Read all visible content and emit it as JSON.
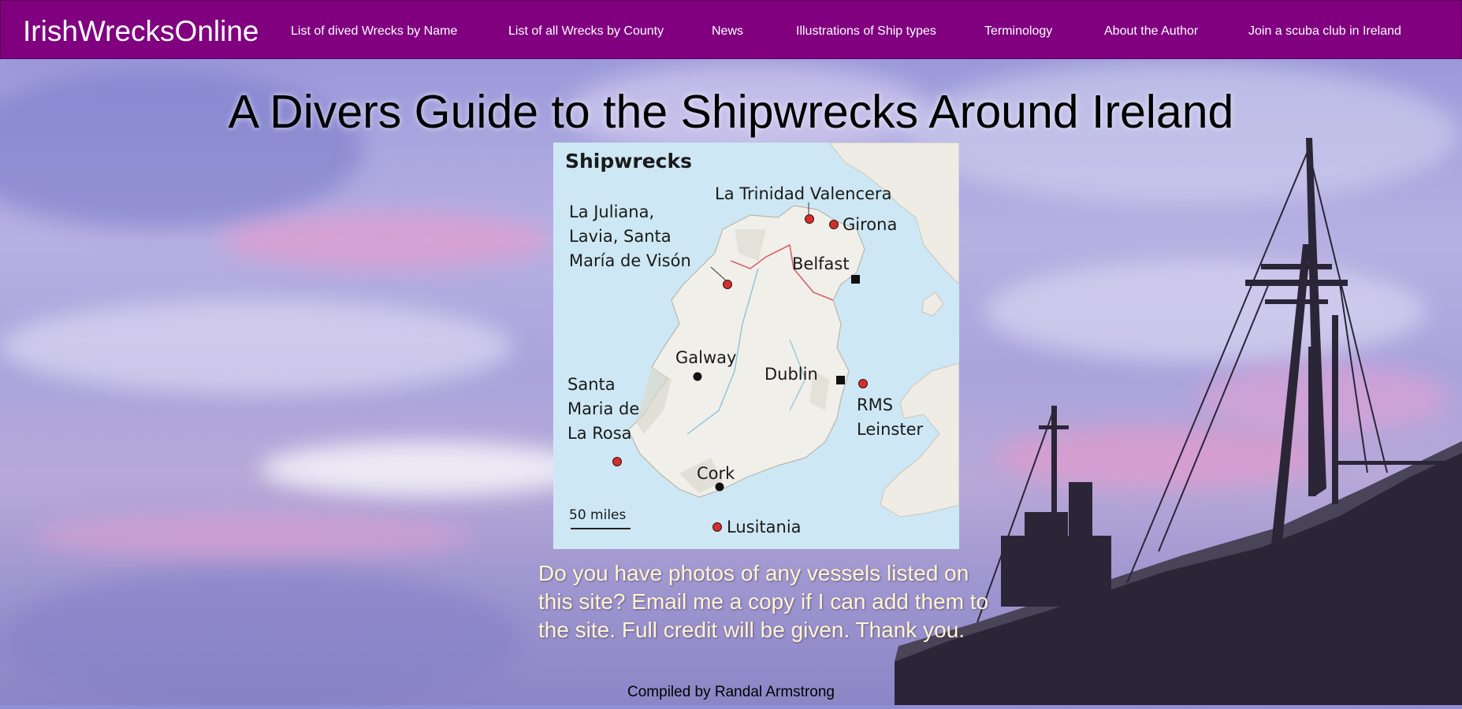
{
  "nav": {
    "brand": "IrishWrecksOnline",
    "links": [
      {
        "label": "List of dived Wrecks by Name"
      },
      {
        "label": "List of all Wrecks by County"
      },
      {
        "label": "News"
      },
      {
        "label": "Illustrations of Ship types"
      },
      {
        "label": "Terminology"
      },
      {
        "label": "About the Author"
      },
      {
        "label": "Join a scuba club in Ireland"
      }
    ]
  },
  "main": {
    "headline": "A Divers Guide to the Shipwrecks Around Ireland",
    "notice": "Do you have photos of any vessels listed on this site? Email me a copy if I can add them to the site. Full credit will be given. Thank you.",
    "credit": "Compiled by Randal Armstrong"
  },
  "map": {
    "title": "Shipwrecks",
    "scale_label": "50 miles",
    "wrecks": [
      {
        "label": "La Trinidad Valencera"
      },
      {
        "label": "Girona"
      },
      {
        "label_lines": [
          "La Juliana,",
          "Lavia, Santa",
          "María de Visón"
        ]
      },
      {
        "label_lines": [
          "Santa",
          "Maria de",
          "La Rosa"
        ]
      },
      {
        "label_lines": [
          "RMS",
          "Leinster"
        ]
      },
      {
        "label": "Lusitania"
      }
    ],
    "cities": [
      {
        "label": "Belfast"
      },
      {
        "label": "Galway"
      },
      {
        "label": "Dublin"
      },
      {
        "label": "Cork"
      }
    ]
  },
  "colors": {
    "navbar": "#800080",
    "wreck_marker": "#d32f2f",
    "sea": "#cde8f4",
    "land": "#f1efe9",
    "notice_text": "#fff6cf"
  }
}
